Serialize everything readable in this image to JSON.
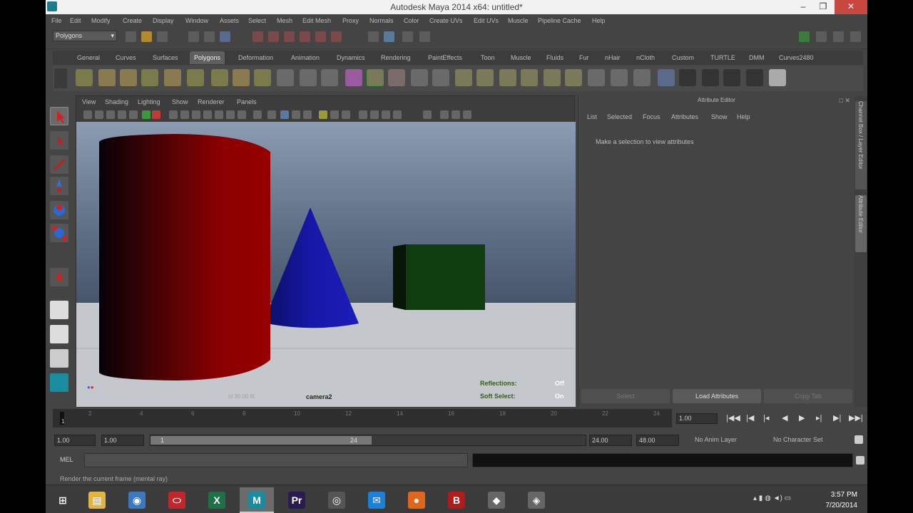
{
  "window": {
    "title": "Autodesk Maya 2014 x64: untitled*",
    "min": "–",
    "max": "❐",
    "close": "✕"
  },
  "menubar": [
    "File",
    "Edit",
    "Modify",
    "Create",
    "Display",
    "Window",
    "Assets",
    "Select",
    "Mesh",
    "Edit Mesh",
    "Proxy",
    "Normals",
    "Color",
    "Create UVs",
    "Edit UVs",
    "Muscle",
    "Pipeline Cache",
    "Help"
  ],
  "status": {
    "mode": "Polygons",
    "mode_chevron": "▾"
  },
  "shelf_tabs": [
    "General",
    "Curves",
    "Surfaces",
    "Polygons",
    "Deformation",
    "Animation",
    "Dynamics",
    "Rendering",
    "PaintEffects",
    "Toon",
    "Muscle",
    "Fluids",
    "Fur",
    "nHair",
    "nCloth",
    "Custom",
    "TURTLE",
    "DMM",
    "Curves2480"
  ],
  "viewport": {
    "menus": [
      "View",
      "Shading",
      "Lighting",
      "Show",
      "Renderer",
      "Panels"
    ],
    "camera_label": "camera2",
    "fps_label": "nl 30.00 fit",
    "hud": {
      "reflections_label": "Reflections:",
      "reflections_value": "Off",
      "soft_select_label": "Soft Select:",
      "soft_select_value": "On"
    }
  },
  "attribute_editor": {
    "title": "Attribute Editor",
    "menus": [
      "List",
      "Selected",
      "Focus",
      "Attributes",
      "Show",
      "Help"
    ],
    "message": "Make a selection to view attributes",
    "buttons": {
      "select": "Select",
      "load": "Load Attributes",
      "copy_tab": "Copy Tab"
    },
    "close_icons": "□ ✕"
  },
  "side_tabs": {
    "channel_box": "Channel Box / Layer Editor",
    "attribute_editor": "Attribute Editor"
  },
  "timeline": {
    "ticks": [
      "1",
      "2",
      "4",
      "6",
      "8",
      "10",
      "12",
      "14",
      "16",
      "18",
      "20",
      "22",
      "24"
    ],
    "current_frame": "1.00",
    "playback_glyphs": [
      "|◀◀",
      "|◀",
      "|◂",
      "◀",
      "▶",
      "▸|",
      "▶|",
      "▶▶|"
    ]
  },
  "range": {
    "start_time": "1.00",
    "playback_start": "1.00",
    "range_start_label": "1",
    "range_end_label": "24",
    "playback_end": "24.00",
    "end_time": "48.00",
    "anim_layer": "No Anim Layer",
    "character_set": "No Character Set"
  },
  "cmd": {
    "label": "MEL",
    "help": "Render the current frame (mental ray)"
  },
  "taskbar": {
    "time": "3:57 PM",
    "date": "7/20/2014",
    "apps": [
      {
        "name": "windows-start-icon",
        "glyph": "⊞",
        "color": "#3b3b3b"
      },
      {
        "name": "file-explorer-icon",
        "glyph": "▤",
        "color": "#e1b544"
      },
      {
        "name": "remote-desktop-icon",
        "glyph": "◉",
        "color": "#3a78c0"
      },
      {
        "name": "acrobat-icon",
        "glyph": "⬭",
        "color": "#c0262a"
      },
      {
        "name": "excel-icon",
        "glyph": "X",
        "color": "#1e7145"
      },
      {
        "name": "maya-icon",
        "glyph": "M",
        "color": "#1a8ca0"
      },
      {
        "name": "premiere-icon",
        "glyph": "Pr",
        "color": "#2b1a4e"
      },
      {
        "name": "media-icon",
        "glyph": "◎",
        "color": "#555555"
      },
      {
        "name": "mail-icon",
        "glyph": "✉",
        "color": "#1c80d8"
      },
      {
        "name": "firefox-icon",
        "glyph": "●",
        "color": "#e0661b"
      },
      {
        "name": "bandicam-icon",
        "glyph": "B",
        "color": "#b01b1b"
      },
      {
        "name": "app-icon-1",
        "glyph": "◆",
        "color": "#666666"
      },
      {
        "name": "app-icon-2",
        "glyph": "◈",
        "color": "#666666"
      }
    ],
    "tray": "▴  ▮  ◍  ◄)  ▭"
  },
  "colors": {
    "cylinder": "#8a0000",
    "cone": "#1a1aa8",
    "cube": "#0f3d0f",
    "sky_top": "#8a9bb0",
    "ground": "#c4c7cc"
  }
}
